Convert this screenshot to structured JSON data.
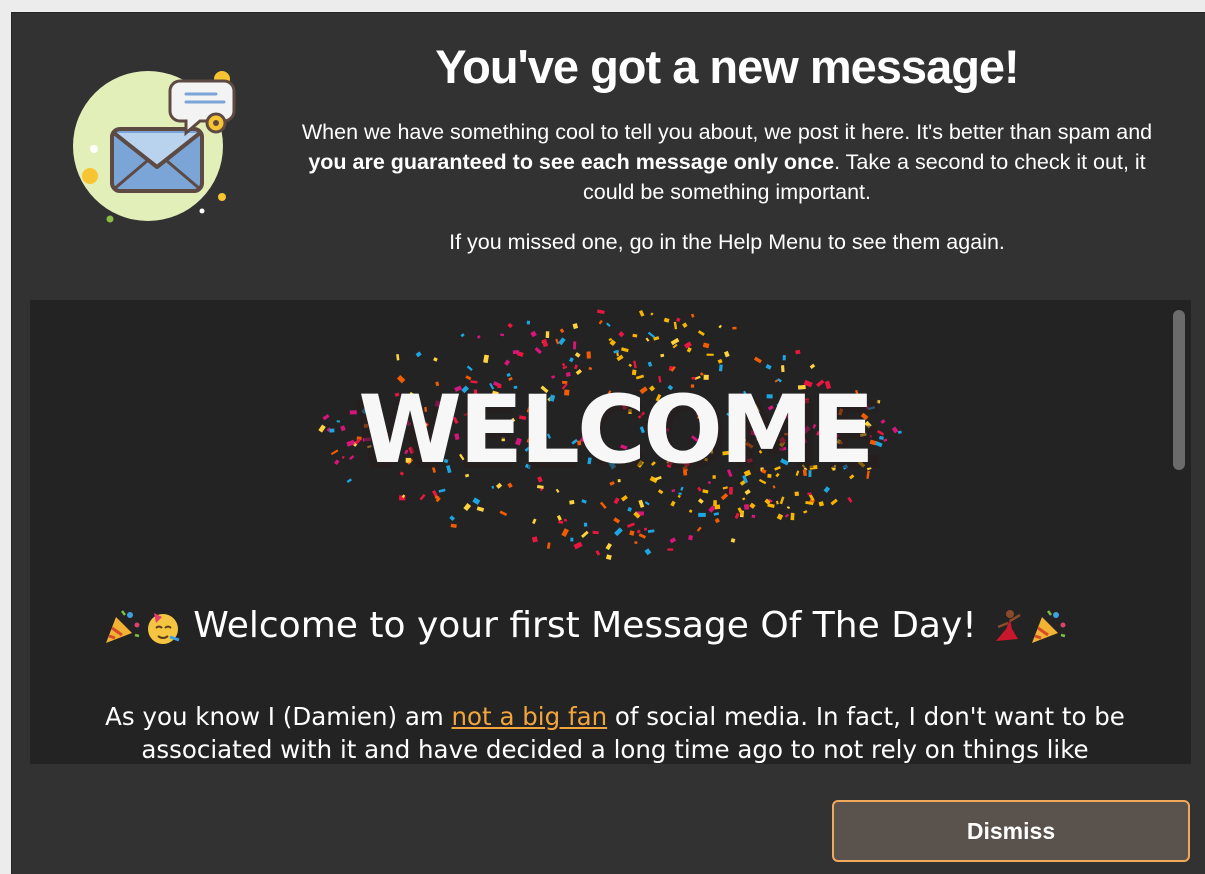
{
  "dialog": {
    "title": "You've got a new message!",
    "intro": {
      "part1": "When we have something cool to tell you about, we post it here. It's better than spam and ",
      "bold": "you are guaranteed to see each message only once",
      "part2": ". Take a second to check it out, it could be something important."
    },
    "missed_note": "If you missed one, go in the Help Menu to see them again.",
    "icon": "envelope-message-icon"
  },
  "message": {
    "banner_text": "WELCOME",
    "heading_text": "Welcome to your first Message Of The Day!",
    "heading_emojis": [
      "party-popper-icon",
      "partying-face-icon",
      "dancer-icon",
      "party-popper-icon"
    ],
    "body": {
      "before_link": "As you know I (Damien) am ",
      "link": "not a big fan",
      "after_link": " of social media. In fact, I don't want to be associated with it and have decided a long time ago to not rely on things like"
    }
  },
  "footer": {
    "dismiss_label": "Dismiss"
  },
  "colors": {
    "window_bg": "#333232",
    "content_bg": "#232323",
    "link": "#f2a53c",
    "button_border": "#f0a85b",
    "button_bg": "#5a524d"
  }
}
